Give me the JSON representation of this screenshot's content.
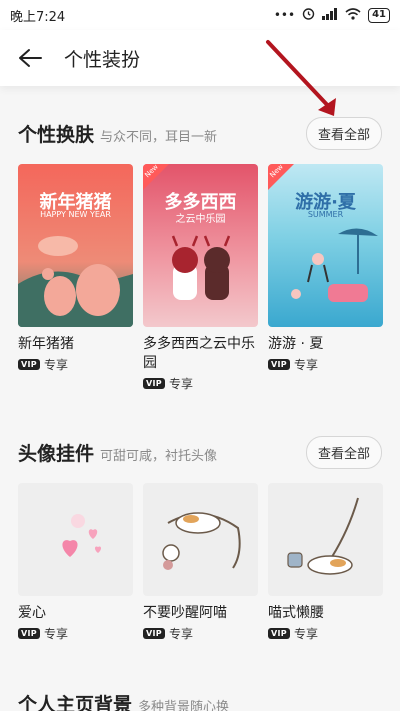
{
  "status": {
    "time": "晚上7:24",
    "battery": "41",
    "dots": "•••"
  },
  "header": {
    "title": "个性装扮"
  },
  "skin_section": {
    "title": "个性换肤",
    "subtitle": "与众不同，耳目一新",
    "view_all": "查看全部",
    "items": [
      {
        "name": "新年猪猪",
        "vip": "VIP",
        "vip_label": "专享",
        "thumb_title": "新年猪猪",
        "thumb_sub": "HAPPY NEW YEAR",
        "color": "#f0685b"
      },
      {
        "name": "多多西西之云中乐园",
        "vip": "VIP",
        "vip_label": "专享",
        "thumb_title": "多多西西",
        "thumb_sub": "之云中乐园",
        "new": "New",
        "color": "#e86a78"
      },
      {
        "name": "游游 · 夏",
        "vip": "VIP",
        "vip_label": "专享",
        "thumb_title": "游游·夏",
        "thumb_sub": "SUMMER",
        "new": "New",
        "color": "#8fd4e8"
      }
    ]
  },
  "avatar_section": {
    "title": "头像挂件",
    "subtitle": "可甜可咸，衬托头像",
    "view_all": "查看全部",
    "items": [
      {
        "name": "爱心",
        "vip": "VIP",
        "vip_label": "专享"
      },
      {
        "name": "不要吵醒阿喵",
        "vip": "VIP",
        "vip_label": "专享"
      },
      {
        "name": "喵式懒腰",
        "vip": "VIP",
        "vip_label": "专享"
      }
    ]
  },
  "bg_section": {
    "title": "个人主页背景",
    "subtitle": "多种背景随心换"
  }
}
